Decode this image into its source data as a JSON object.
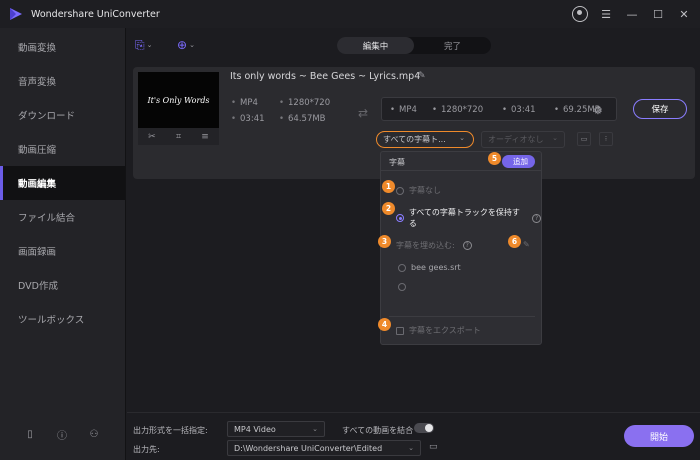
{
  "app": {
    "title": "Wondershare UniConverter",
    "brand_color": "#7b6bff",
    "highlight_color": "#ef8a2b"
  },
  "window_controls": [
    "avatar-icon",
    "menu-icon",
    "minimize-icon",
    "maximize-icon",
    "close-icon"
  ],
  "sidebar": {
    "items": [
      {
        "label": "動画変換",
        "active": false
      },
      {
        "label": "音声変換",
        "active": false
      },
      {
        "label": "ダウンロード",
        "active": false
      },
      {
        "label": "動画圧縮",
        "active": false
      },
      {
        "label": "動画編集",
        "active": true
      },
      {
        "label": "ファイル結合",
        "active": false
      },
      {
        "label": "画面録画",
        "active": false
      },
      {
        "label": "DVD作成",
        "active": false
      },
      {
        "label": "ツールボックス",
        "active": false
      }
    ],
    "bottom_icons": [
      "book-icon",
      "help-icon",
      "account-icon"
    ]
  },
  "tabs": [
    {
      "label": "編集中",
      "active": true
    },
    {
      "label": "完了",
      "active": false
    }
  ],
  "file": {
    "name": "Its only words ~ Bee Gees ~ Lyrics.mp4",
    "thumbnail_text": "It's Only Words",
    "source": {
      "format": "MP4",
      "resolution": "1280*720",
      "duration": "03:41",
      "size": "64.57MB"
    },
    "output": {
      "format": "MP4",
      "resolution": "1280*720",
      "duration": "03:41",
      "size": "69.25MB"
    },
    "save_label": "保存",
    "subtitle_select": "すべての字幕ト...",
    "audio_select": "オーディオなし"
  },
  "subtitle_menu": {
    "title": "字幕",
    "add_label": "追加",
    "options": [
      {
        "label": "字幕なし",
        "selected": false
      },
      {
        "label": "すべての字幕トラックを保持する",
        "selected": true
      }
    ],
    "embed_label": "字幕を埋め込む:",
    "files": [
      "bee gees.srt",
      ""
    ],
    "export_label": "字幕をエクスポート",
    "badges": [
      "1",
      "2",
      "3",
      "4",
      "5",
      "6"
    ]
  },
  "bottom": {
    "format_label": "出力形式を一括指定:",
    "format_value": "MP4 Video",
    "merge_label": "すべての動画を結合",
    "merge_on": false,
    "dest_label": "出力先:",
    "dest_value": "D:\\Wondershare UniConverter\\Edited",
    "start_label": "開始"
  }
}
